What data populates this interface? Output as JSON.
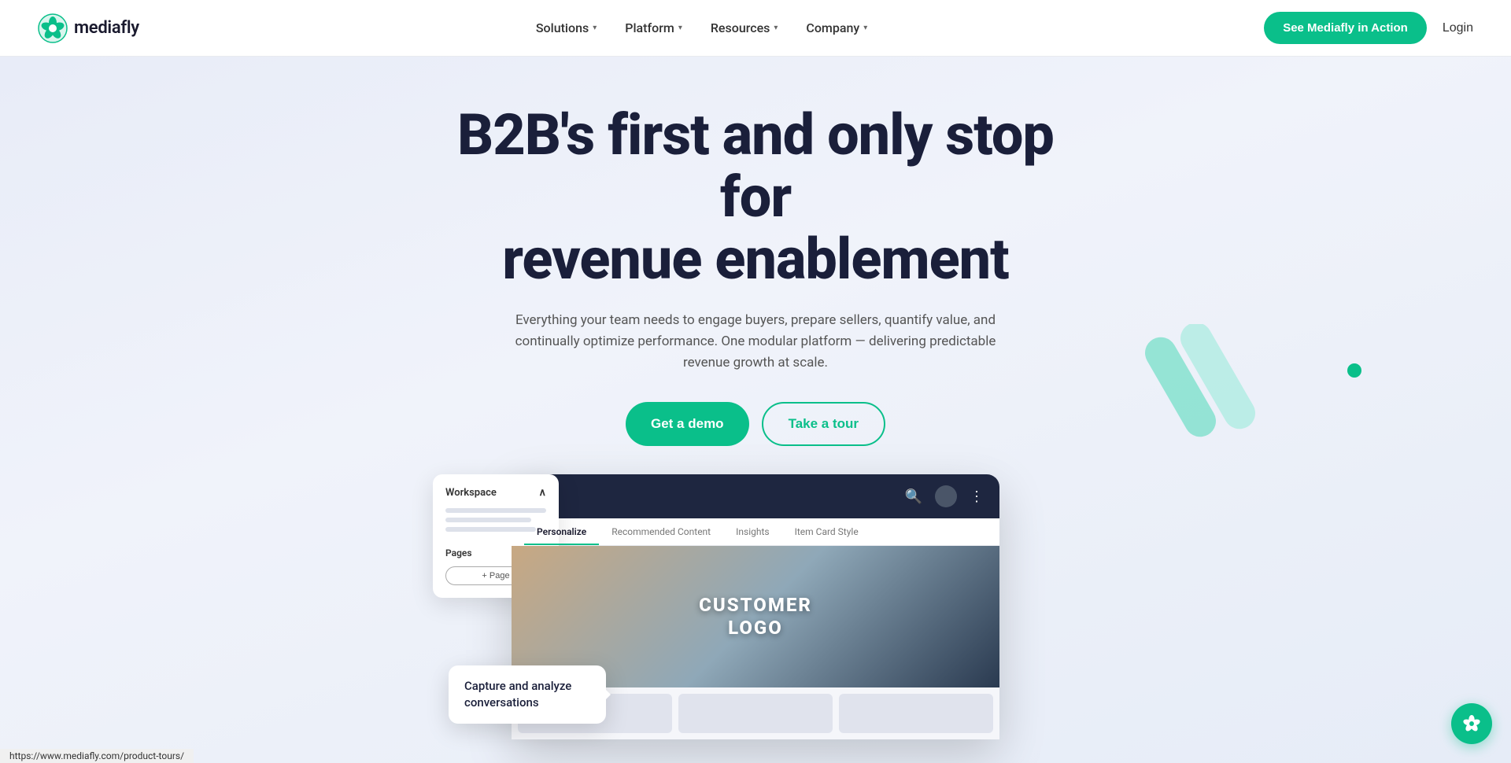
{
  "nav": {
    "logo_text": "mediafly",
    "links": [
      {
        "label": "Solutions",
        "has_dropdown": true
      },
      {
        "label": "Platform",
        "has_dropdown": true
      },
      {
        "label": "Resources",
        "has_dropdown": true
      },
      {
        "label": "Company",
        "has_dropdown": true
      }
    ],
    "cta_label": "See Mediafly in Action",
    "login_label": "Login"
  },
  "hero": {
    "title_line1": "B2B's first and only stop for",
    "title_line2": "revenue enablement",
    "subtitle": "Everything your team needs to engage buyers, prepare sellers, quantify value, and continually optimize performance. One modular platform — delivering predictable revenue growth at scale.",
    "btn_demo": "Get a demo",
    "btn_tour": "Take a tour"
  },
  "mockup": {
    "sidebar_title": "Workspace",
    "pages_label": "Pages",
    "add_page": "+ Page",
    "tabs": [
      "Personalize",
      "Recommended Content",
      "Insights",
      "Item Card Style"
    ],
    "active_tab": 0,
    "customer_logo_line1": "CUSTOMER",
    "customer_logo_line2": "LOGO"
  },
  "tooltip": {
    "text": "Capture and analyze conversations"
  },
  "url_bar": {
    "text": "https://www.mediafly.com/product-tours/"
  },
  "bottom_badge": {
    "icon": "leaf-icon"
  }
}
